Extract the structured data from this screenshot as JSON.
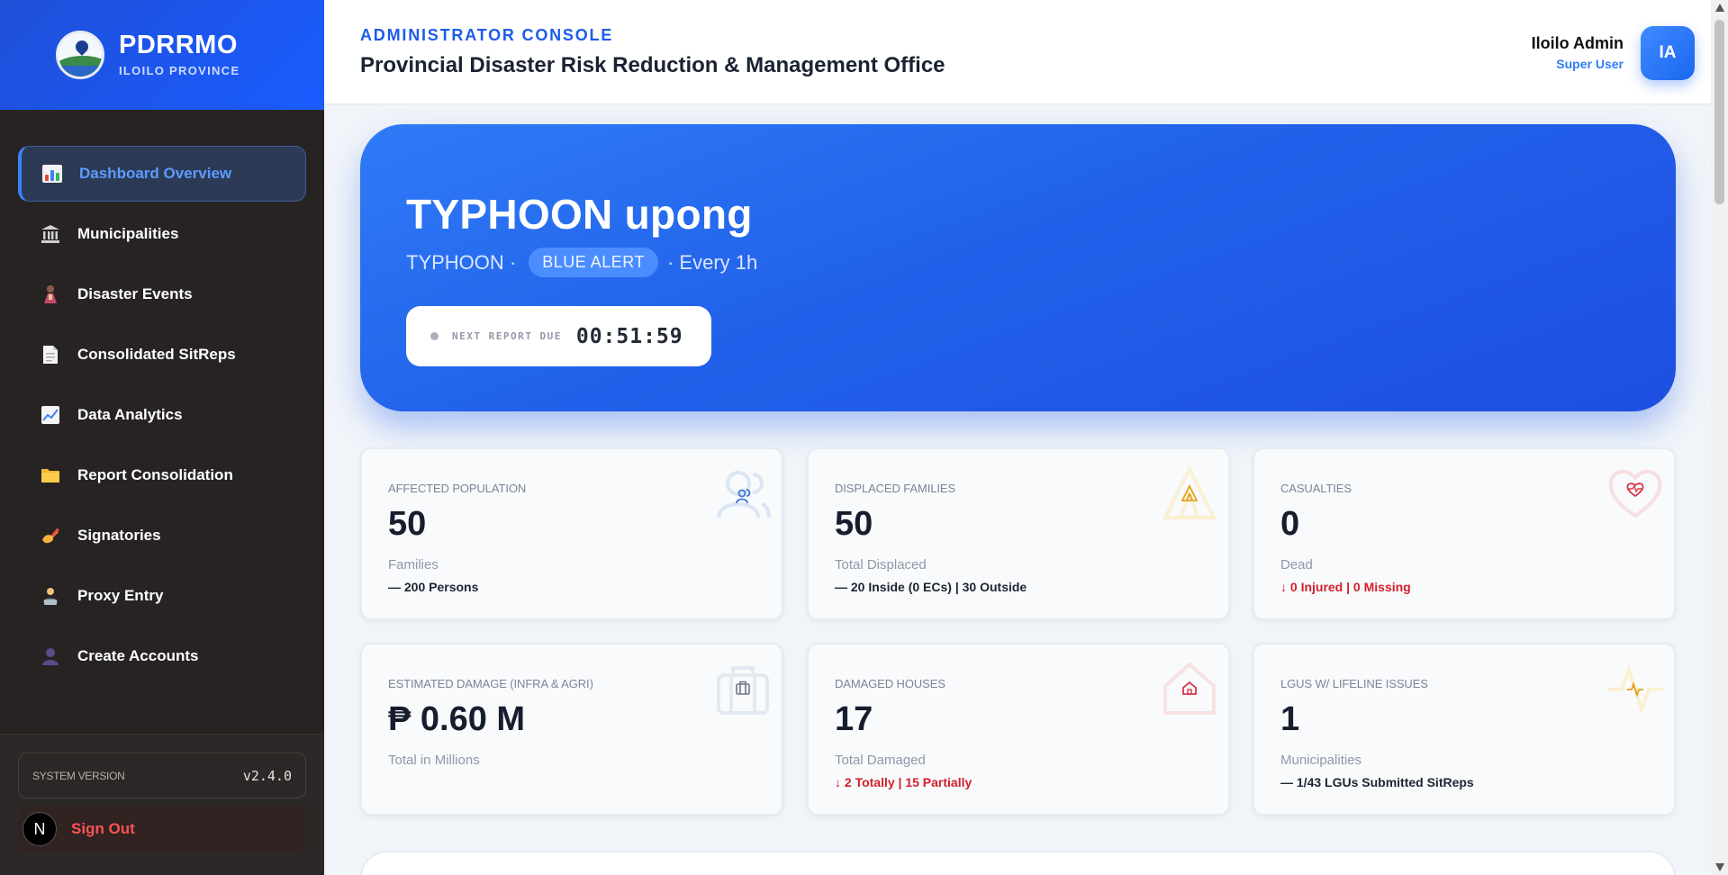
{
  "brand": {
    "title": "PDRRMO",
    "subtitle": "ILOILO PROVINCE"
  },
  "sidebar": {
    "items": [
      {
        "label": "Dashboard Overview",
        "icon": "bar-chart-icon",
        "active": true
      },
      {
        "label": "Municipalities",
        "icon": "building-icon"
      },
      {
        "label": "Disaster Events",
        "icon": "disaster-icon"
      },
      {
        "label": "Consolidated SitReps",
        "icon": "document-icon"
      },
      {
        "label": "Data Analytics",
        "icon": "line-chart-icon"
      },
      {
        "label": "Report Consolidation",
        "icon": "folder-icon"
      },
      {
        "label": "Signatories",
        "icon": "writing-hand-icon"
      },
      {
        "label": "Proxy Entry",
        "icon": "technician-icon"
      },
      {
        "label": "Create Accounts",
        "icon": "user-icon"
      }
    ],
    "version_label": "SYSTEM VERSION",
    "version_value": "v2.4.0",
    "signout_badge": "N",
    "signout_label": "Sign Out"
  },
  "header": {
    "eyebrow": "ADMINISTRATOR CONSOLE",
    "office": "Provincial Disaster Risk Reduction & Management Office",
    "user_name": "Iloilo Admin",
    "user_role": "Super User",
    "avatar_initials": "IA"
  },
  "hero": {
    "title": "TYPHOON upong",
    "type": "TYPHOON ·",
    "alert": "BLUE ALERT",
    "frequency": "· Every 1h",
    "timer_label": "NEXT REPORT DUE",
    "timer_value": "00:51:59"
  },
  "cards": [
    {
      "label": "AFFECTED POPULATION",
      "value": "50",
      "sub": "Families",
      "note": "— 200 Persons",
      "icon": "people-icon"
    },
    {
      "label": "DISPLACED FAMILIES",
      "value": "50",
      "sub": "Total Displaced",
      "note": "— 20 Inside (0 ECs) | 30 Outside",
      "icon": "tent-icon"
    },
    {
      "label": "CASUALTIES",
      "value": "0",
      "sub": "Dead",
      "note": "↓ 0 Injured | 0 Missing",
      "icon": "heart-pulse-icon"
    },
    {
      "label": "ESTIMATED DAMAGE (INFRA & AGRI)",
      "value": "₱ 0.60 M",
      "sub": "Total in Millions",
      "note": "",
      "icon": "briefcase-icon"
    },
    {
      "label": "DAMAGED HOUSES",
      "value": "17",
      "sub": "Total Damaged",
      "note": "↓ 2 Totally | 15 Partially",
      "icon": "house-icon"
    },
    {
      "label": "LGUS W/ LIFELINE ISSUES",
      "value": "1",
      "sub": "Municipalities",
      "note": "— 1/43 LGUs Submitted SitReps",
      "icon": "pulse-icon"
    }
  ],
  "colors": {
    "brand_blue": "#1a5cff",
    "sidebar_bg": "#262322",
    "active_text": "#5b9cff",
    "danger": "#d21f2a",
    "signout": "#ff5252"
  }
}
